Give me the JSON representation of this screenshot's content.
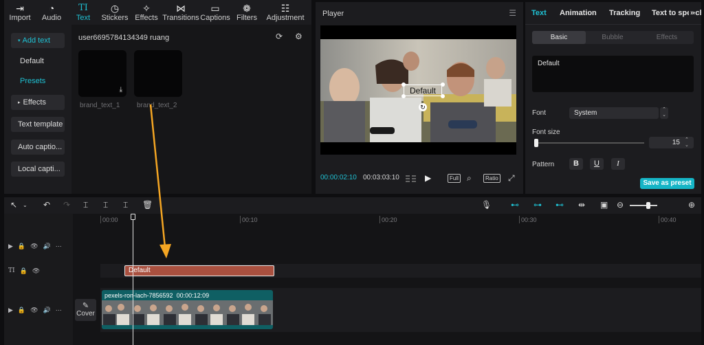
{
  "toolbar": {
    "items": [
      {
        "label": "Import",
        "icon": "import-icon"
      },
      {
        "label": "Audio",
        "icon": "audio-icon"
      },
      {
        "label": "Text",
        "icon": "text-icon"
      },
      {
        "label": "Stickers",
        "icon": "stickers-icon"
      },
      {
        "label": "Effects",
        "icon": "effects-icon"
      },
      {
        "label": "Transitions",
        "icon": "transitions-icon"
      },
      {
        "label": "Captions",
        "icon": "captions-icon"
      },
      {
        "label": "Filters",
        "icon": "filters-icon"
      },
      {
        "label": "Adjustment",
        "icon": "adjustment-icon"
      }
    ],
    "active": "Text",
    "text_glyph": "TI"
  },
  "left_nav": {
    "add_text": "Add text",
    "default": "Default",
    "presets": "Presets",
    "effects": "Effects",
    "text_template": "Text template",
    "auto_captions": "Auto captio...",
    "local_captions": "Local capti..."
  },
  "library": {
    "user": "user6695784134349 ruang",
    "cards": [
      {
        "label": "brand_text_1",
        "downloadable": true
      },
      {
        "label": "brand_text_2",
        "downloadable": false
      }
    ]
  },
  "player": {
    "title": "Player",
    "overlay_text": "Default",
    "current_time": "00:00:02:10",
    "total_time": "00:03:03:10",
    "full_label": "Full",
    "ratio_label": "Ratio"
  },
  "right_panel": {
    "tabs": [
      "Text",
      "Animation",
      "Tracking",
      "Text to speech"
    ],
    "active_tab": "Text",
    "subtabs": [
      "Basic",
      "Bubble",
      "Effects"
    ],
    "active_subtab": "Basic",
    "text_value": "Default",
    "font_label": "Font",
    "font_value": "System",
    "font_size_label": "Font size",
    "font_size_value": "15",
    "pattern_label": "Pattern",
    "pattern_buttons": [
      "B",
      "U",
      "I"
    ],
    "save_preset": "Save as preset"
  },
  "timeline": {
    "ruler_ticks": [
      "00:00",
      "00:10",
      "00:20",
      "00:30",
      "00:40"
    ],
    "text_clip": "Default",
    "video_clip_name": "pexels-ron-lach-7856592",
    "video_clip_duration": "00:00:12:09",
    "cover_label": "Cover"
  },
  "colors": {
    "accent": "#1fc2d4",
    "text_clip": "#a9503f",
    "video_clip": "#0f5f63",
    "annotation_arrow": "#f5a623"
  }
}
